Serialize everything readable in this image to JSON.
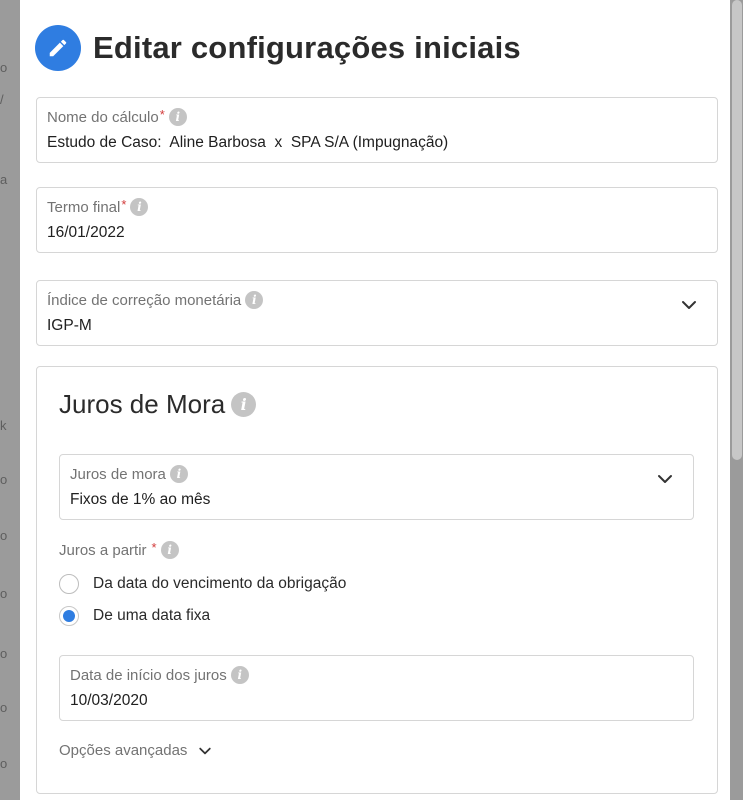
{
  "modal": {
    "title": "Editar configurações iniciais"
  },
  "fields": {
    "nome_calculo": {
      "label": "Nome do cálculo",
      "required_mark": "*",
      "value": "Estudo de Caso:  Aline Barbosa  x  SPA S/A (Impugnação)"
    },
    "termo_final": {
      "label": "Termo final",
      "required_mark": "*",
      "value": "16/01/2022"
    },
    "indice_correcao": {
      "label": "Índice de correção monetária",
      "value": "IGP-M"
    }
  },
  "juros": {
    "section_title": "Juros de Mora",
    "tipo": {
      "label": "Juros de mora",
      "value": "Fixos de 1% ao mês"
    },
    "a_partir": {
      "label": "Juros a partir",
      "required_mark": "*",
      "options": [
        {
          "label": "Da data do vencimento da obrigação",
          "checked": false
        },
        {
          "label": "De uma data fixa",
          "checked": true
        }
      ]
    },
    "data_inicio": {
      "label": "Data de início dos juros",
      "value": "10/03/2020"
    },
    "advanced_label": "Opções avançadas"
  },
  "icons": {
    "edit": "pencil-icon",
    "info": "info-icon",
    "dropdown": "chevron-down-icon"
  },
  "colors": {
    "accent": "#2f7de1",
    "required": "#d23a3a"
  }
}
